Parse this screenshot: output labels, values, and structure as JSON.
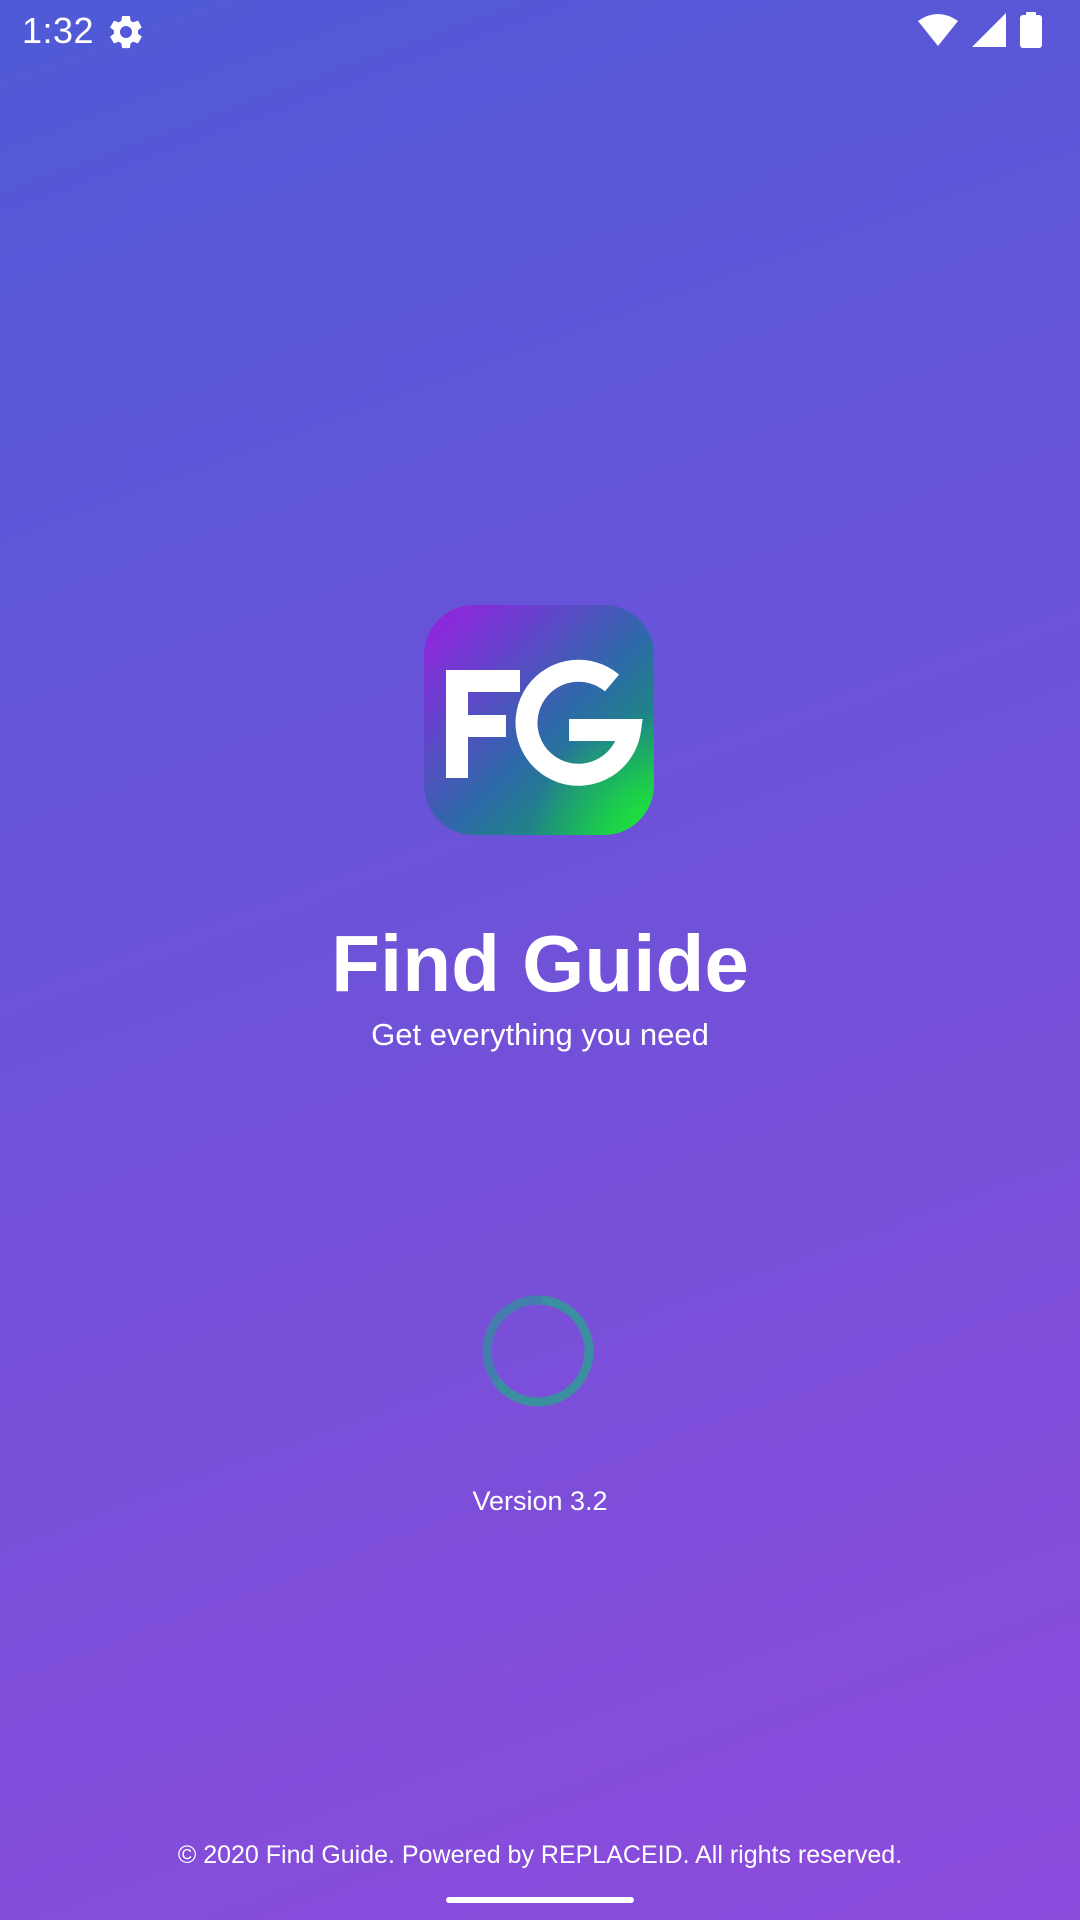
{
  "status_bar": {
    "time": "1:32",
    "icons": [
      "settings-icon",
      "wifi-icon",
      "cell-signal-icon",
      "battery-icon"
    ]
  },
  "logo": {
    "icon": "fg-logo-icon",
    "colors": [
      "#9a1fe0",
      "#2d6aa8",
      "#18c847"
    ]
  },
  "app": {
    "title": "Find Guide",
    "tagline": "Get everything you need",
    "version": "Version 3.2"
  },
  "loading": {
    "icon": "loading-spinner-icon",
    "color": "#3c8fa0"
  },
  "footer": {
    "copyright": "© 2020 Find Guide. Powered by REPLACEID. All rights reserved."
  },
  "colors": {
    "background_top": "#4f5ad6",
    "background_bottom": "#8d4bdc",
    "text": "#ffffff"
  }
}
